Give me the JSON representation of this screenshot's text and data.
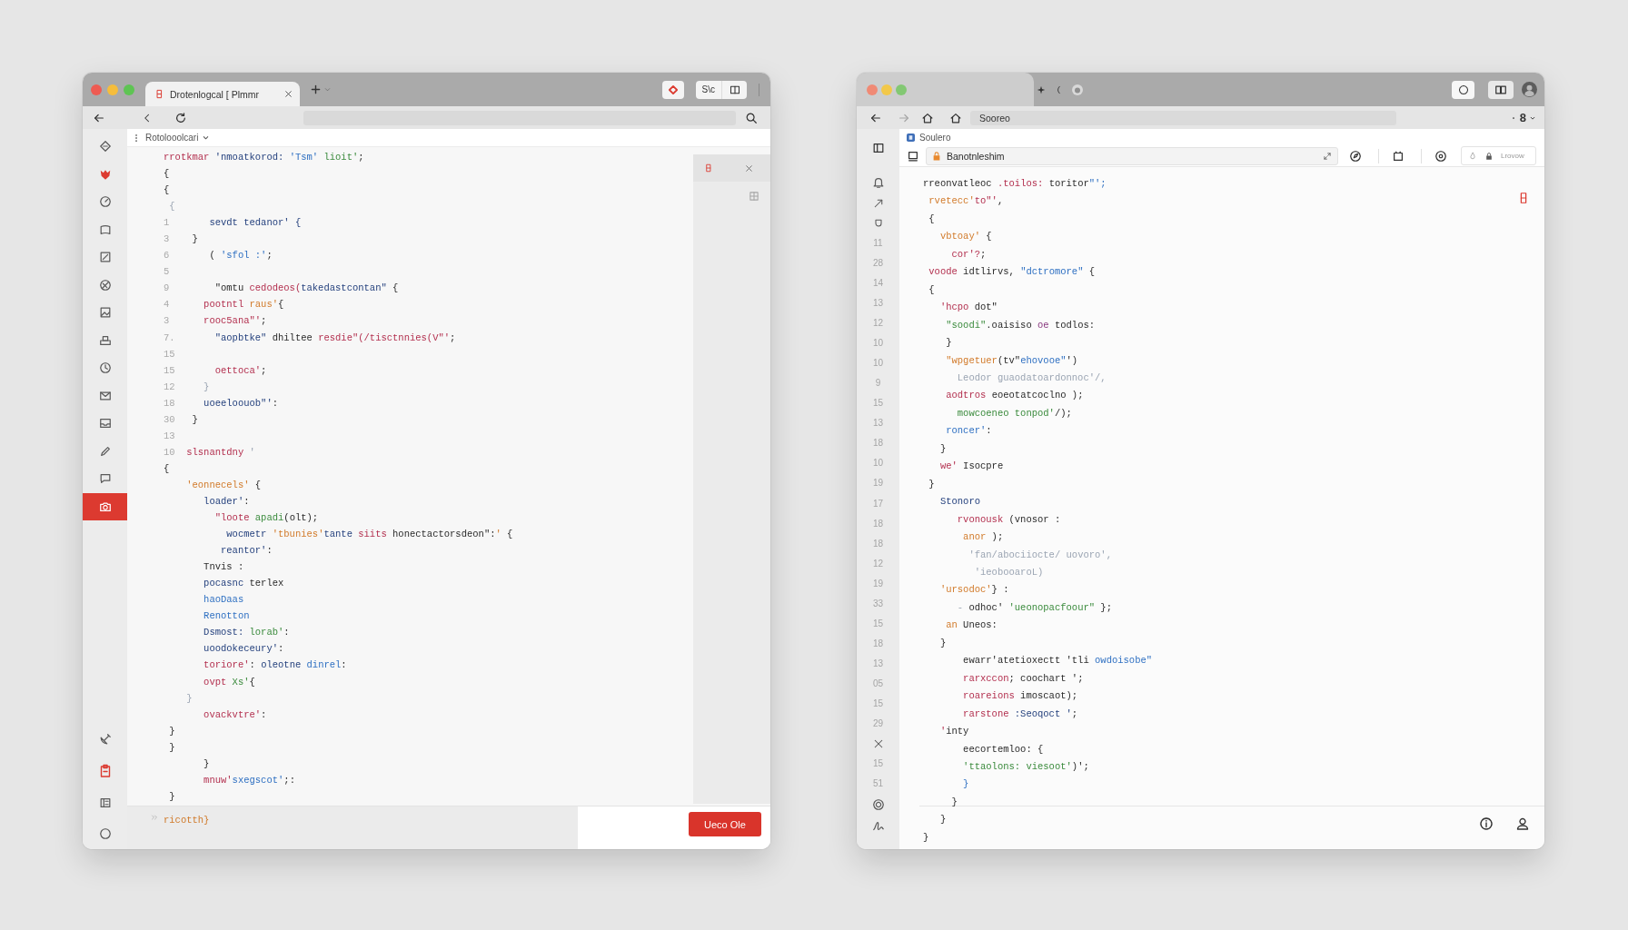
{
  "window_left": {
    "tab_title": "Drotenlogcal [ Plmmr",
    "titlebar_button": "S\\c",
    "breadcrumb": "Rotolooolcari",
    "sidebar": {
      "items": [
        {
          "selected": false
        },
        {
          "selected": false
        },
        {
          "selected": false
        },
        {
          "selected": false
        },
        {
          "selected": false
        },
        {
          "selected": false
        },
        {
          "selected": false
        },
        {
          "selected": false
        },
        {
          "selected": false
        },
        {
          "selected": false
        },
        {
          "selected": false
        },
        {
          "selected": false
        },
        {
          "selected": false
        },
        {
          "selected": true
        }
      ]
    },
    "code_lines": [
      {
        "code": [
          {
            "text": "rrotkmar ",
            "kind": "keyword"
          },
          {
            "text": "'nmoatkorod: ",
            "kind": "name"
          },
          {
            "text": "'Tsm' ",
            "kind": "type"
          },
          {
            "text": "lioit'",
            "kind": "string"
          },
          {
            "text": ";",
            "kind": "plain"
          }
        ]
      },
      {
        "code": [
          {
            "text": "{",
            "kind": "plain"
          }
        ]
      },
      {
        "code": [
          {
            "text": "{",
            "kind": "plain"
          }
        ]
      },
      {
        "code": [
          {
            "text": " {",
            "kind": "muted"
          }
        ]
      },
      {
        "num": "1",
        "code": [
          {
            "text": "        sevdt tedanor' {",
            "kind": "name"
          }
        ]
      },
      {
        "num": "3",
        "code": [
          {
            "text": "     }",
            "kind": "plain"
          }
        ]
      },
      {
        "num": "6",
        "code": [
          {
            "text": "        ( ",
            "kind": "plain"
          },
          {
            "text": "'sfol :'",
            "kind": "type"
          },
          {
            "text": ";",
            "kind": "plain"
          }
        ]
      },
      {
        "num": "5"
      },
      {
        "num": "9",
        "code": [
          {
            "text": "         \"omtu ",
            "kind": "plain"
          },
          {
            "text": "cedodeos(",
            "kind": "keyword"
          },
          {
            "text": "takedastcontan\"",
            "kind": "name"
          },
          {
            "text": " {",
            "kind": "plain"
          }
        ]
      },
      {
        "num": "4",
        "code": [
          {
            "text": "       pootntl ",
            "kind": "keyword"
          },
          {
            "text": "raus'",
            "kind": "attr"
          },
          {
            "text": "{",
            "kind": "plain"
          }
        ]
      },
      {
        "num": "3",
        "code": [
          {
            "text": "       rooc5ana\"'",
            "kind": "keyword"
          },
          {
            "text": ";",
            "kind": "plain"
          }
        ]
      },
      {
        "num": "7.",
        "code": [
          {
            "text": "         \"aopbtke\" ",
            "kind": "name"
          },
          {
            "text": "dhiltee ",
            "kind": "plain"
          },
          {
            "text": "resdie\"(/tisctnnies(V\"'",
            "kind": "keyword"
          },
          {
            "text": ";",
            "kind": "plain"
          }
        ]
      },
      {
        "num": "15"
      },
      {
        "num": "15",
        "code": [
          {
            "text": "         oettoca'",
            "kind": "keyword"
          },
          {
            "text": ";",
            "kind": "plain"
          }
        ]
      },
      {
        "num": "12",
        "code": [
          {
            "text": "       }",
            "kind": "muted"
          }
        ]
      },
      {
        "num": "18",
        "code": [
          {
            "text": "       uoeeloouob\"'",
            "kind": "name"
          },
          {
            "text": ":",
            "kind": "plain"
          }
        ]
      },
      {
        "num": "30",
        "code": [
          {
            "text": "     }",
            "kind": "plain"
          }
        ]
      },
      {
        "num": "13"
      },
      {
        "num": "10",
        "code": [
          {
            "text": "    slsnantdny ",
            "kind": "keyword"
          },
          {
            "text": "'",
            "kind": "muted"
          }
        ]
      },
      {
        "code": [
          {
            "text": "{",
            "kind": "plain"
          }
        ]
      },
      {
        "code": [
          {
            "text": "    'eonnecels'",
            "kind": "attr"
          },
          {
            "text": " {",
            "kind": "plain"
          }
        ]
      },
      {
        "code": [
          {
            "text": "       loader'",
            "kind": "name"
          },
          {
            "text": ":",
            "kind": "plain"
          }
        ]
      },
      {
        "code": [
          {
            "text": "         \"loote ",
            "kind": "keyword"
          },
          {
            "text": "apadi",
            "kind": "string"
          },
          {
            "text": "(olt);",
            "kind": "plain"
          }
        ]
      },
      {
        "code": [
          {
            "text": "           wocmetr ",
            "kind": "name"
          },
          {
            "text": "'tbunies'",
            "kind": "attr"
          },
          {
            "text": "tante ",
            "kind": "name"
          },
          {
            "text": "siits ",
            "kind": "keyword"
          },
          {
            "text": "honectactorsdeon\":",
            "kind": "plain"
          },
          {
            "text": "'",
            "kind": "attr"
          },
          {
            "text": " {",
            "kind": "plain"
          }
        ]
      },
      {
        "code": [
          {
            "text": "          reantor'",
            "kind": "name"
          },
          {
            "text": ":",
            "kind": "plain"
          }
        ]
      },
      {
        "code": [
          {
            "text": "       Tnvis :",
            "kind": "plain"
          }
        ]
      },
      {
        "code": [
          {
            "text": "       pocasnc ",
            "kind": "name"
          },
          {
            "text": "terlex",
            "kind": "plain"
          }
        ]
      },
      {
        "code": [
          {
            "text": "       haoDaas",
            "kind": "type"
          }
        ]
      },
      {
        "code": [
          {
            "text": "       Renotton",
            "kind": "type"
          }
        ]
      },
      {
        "code": [
          {
            "text": "       Dsmost: ",
            "kind": "name"
          },
          {
            "text": "lorab'",
            "kind": "string"
          },
          {
            "text": ":",
            "kind": "plain"
          }
        ]
      },
      {
        "code": [
          {
            "text": "       uoodokeceury'",
            "kind": "name"
          },
          {
            "text": ":",
            "kind": "plain"
          }
        ]
      },
      {
        "code": [
          {
            "text": "       toriore'",
            "kind": "keyword"
          },
          {
            "text": ": ",
            "kind": "plain"
          },
          {
            "text": "oleotne ",
            "kind": "name"
          },
          {
            "text": "dinrel",
            "kind": "type"
          },
          {
            "text": ":",
            "kind": "plain"
          }
        ]
      },
      {
        "code": [
          {
            "text": "       ovpt ",
            "kind": "keyword"
          },
          {
            "text": "Xs'",
            "kind": "string"
          },
          {
            "text": "{",
            "kind": "plain"
          }
        ]
      },
      {
        "code": [
          {
            "text": "    }",
            "kind": "muted"
          }
        ]
      },
      {
        "code": [
          {
            "text": "       ovackvtre'",
            "kind": "keyword"
          },
          {
            "text": ":",
            "kind": "plain"
          }
        ]
      },
      {
        "code": [
          {
            "text": " }",
            "kind": "plain"
          }
        ]
      },
      {
        "code": [
          {
            "text": " }",
            "kind": "plain"
          }
        ]
      },
      {
        "code": [
          {
            "text": "       }",
            "kind": "plain"
          }
        ]
      },
      {
        "code": [
          {
            "text": "       mnuw'",
            "kind": "keyword"
          },
          {
            "text": "sxegscot'",
            "kind": "type"
          },
          {
            "text": ";:",
            "kind": "plain"
          }
        ]
      },
      {
        "code": [
          {
            "text": " }",
            "kind": "plain"
          }
        ]
      }
    ],
    "status_bar": {
      "text": "ricotth}"
    },
    "button": "Ueco Ole"
  },
  "window_right": {
    "address_field": {
      "value": "Sooreo"
    },
    "tab_count": "8",
    "breadcrumb": "Soulero",
    "search_field": {
      "value": "Banotnleshim"
    },
    "toolbar_button": "Lrovow",
    "line_numbers": [
      "11",
      "28",
      "14",
      "13",
      "12",
      "10",
      "10",
      "9",
      "15",
      "13",
      "18",
      "10",
      "19",
      "17",
      "18",
      "18",
      "12",
      "19",
      "33",
      "15",
      "18",
      "13",
      "05",
      "15",
      "29"
    ],
    "lower_line_numbers": [
      "15",
      "51"
    ],
    "code_lines": [
      {
        "code": [
          {
            "text": "rreonvatleoc ",
            "kind": "plain"
          },
          {
            "text": ".toilos: ",
            "kind": "keyword"
          },
          {
            "text": "toritor",
            "kind": "plain"
          },
          {
            "text": "\"';",
            "kind": "type"
          }
        ]
      },
      {
        "code": [
          {
            "text": " rvetecc'",
            "kind": "attr"
          },
          {
            "text": "to\"'",
            "kind": "keyword"
          },
          {
            "text": ",",
            "kind": "plain"
          }
        ]
      },
      {
        "code": [
          {
            "text": " {",
            "kind": "plain"
          }
        ]
      },
      {
        "code": [
          {
            "text": "   vbtoay'",
            "kind": "attr"
          },
          {
            "text": " {",
            "kind": "plain"
          }
        ]
      },
      {
        "code": [
          {
            "text": "     cor'?",
            "kind": "keyword"
          },
          {
            "text": ";",
            "kind": "plain"
          }
        ]
      },
      {
        "code": [
          {
            "text": " voode ",
            "kind": "keyword"
          },
          {
            "text": "idtlirvs, ",
            "kind": "plain"
          },
          {
            "text": "\"dctromore\"",
            "kind": "type"
          },
          {
            "text": " {",
            "kind": "plain"
          }
        ]
      },
      {
        "code": [
          {
            "text": " {",
            "kind": "plain"
          }
        ]
      },
      {
        "code": [
          {
            "text": "   'hcpo ",
            "kind": "keyword"
          },
          {
            "text": "dot\"",
            "kind": "plain"
          }
        ]
      },
      {
        "code": [
          {
            "text": "    \"soodi\"",
            "kind": "string"
          },
          {
            "text": ".oaisiso ",
            "kind": "plain"
          },
          {
            "text": "oe ",
            "kind": "constant"
          },
          {
            "text": "todlos:",
            "kind": "plain"
          }
        ]
      },
      {
        "code": [
          {
            "text": "    }",
            "kind": "plain"
          }
        ]
      },
      {
        "code": [
          {
            "text": "    \"wpgetuer",
            "kind": "attr"
          },
          {
            "text": "(tv\"",
            "kind": "plain"
          },
          {
            "text": "ehovooe\"",
            "kind": "type"
          },
          {
            "text": "')",
            "kind": "plain"
          }
        ]
      },
      {
        "code": [
          {
            "text": "      Leodor guaodatoardonnoc'/,",
            "kind": "muted"
          }
        ]
      },
      {
        "code": [
          {
            "text": "    aodtros ",
            "kind": "keyword"
          },
          {
            "text": "eoeotatcoclno );",
            "kind": "plain"
          }
        ]
      },
      {
        "code": [
          {
            "text": "      mowcoeneo tonpod'",
            "kind": "string"
          },
          {
            "text": "/);",
            "kind": "plain"
          }
        ]
      },
      {
        "code": [
          {
            "text": "    roncer'",
            "kind": "type"
          },
          {
            "text": ":",
            "kind": "plain"
          }
        ]
      },
      {
        "code": [
          {
            "text": "   }",
            "kind": "plain"
          }
        ]
      },
      {
        "code": [
          {
            "text": "   we' ",
            "kind": "keyword"
          },
          {
            "text": "Isocpre",
            "kind": "plain"
          }
        ]
      },
      {
        "code": [
          {
            "text": " }",
            "kind": "plain"
          }
        ]
      },
      {
        "code": [
          {
            "text": "   Stonoro",
            "kind": "name"
          }
        ]
      },
      {
        "code": [
          {
            "text": "      rvonousk ",
            "kind": "keyword"
          },
          {
            "text": "(vnosor :",
            "kind": "plain"
          }
        ]
      },
      {
        "code": [
          {
            "text": "       anor ",
            "kind": "attr"
          },
          {
            "text": ");",
            "kind": "plain"
          }
        ]
      },
      {
        "code": [
          {
            "text": "        'fan/abociiocte/ uovoro',",
            "kind": "muted"
          }
        ]
      },
      {
        "code": [
          {
            "text": "         'ieobooaroL)",
            "kind": "muted"
          }
        ]
      },
      {
        "code": [
          {
            "text": "   'ursodoc'",
            "kind": "attr"
          },
          {
            "text": "} :",
            "kind": "plain"
          }
        ]
      },
      {
        "code": [
          {
            "text": "      - ",
            "kind": "muted"
          },
          {
            "text": "odhoc' ",
            "kind": "plain"
          },
          {
            "text": "'ueonopacfoour\"",
            "kind": "string"
          },
          {
            "text": " };",
            "kind": "plain"
          }
        ]
      },
      {
        "code": [
          {
            "text": "    an ",
            "kind": "attr"
          },
          {
            "text": "Uneos:",
            "kind": "plain"
          }
        ]
      },
      {
        "code": [
          {
            "text": "   }",
            "kind": "plain"
          }
        ]
      },
      {
        "code": [
          {
            "text": "       ewarr'atetioxectt 'tli ",
            "kind": "plain"
          },
          {
            "text": "owdoisobe\"",
            "kind": "type"
          }
        ]
      },
      {
        "code": [
          {
            "text": "       rarxccon",
            "kind": "keyword"
          },
          {
            "text": "; coochart ';",
            "kind": "plain"
          }
        ]
      },
      {
        "code": [
          {
            "text": "       roareions ",
            "kind": "keyword"
          },
          {
            "text": "imoscaot);",
            "kind": "plain"
          }
        ]
      },
      {
        "code": [
          {
            "text": "       rarstone ",
            "kind": "keyword"
          },
          {
            "text": ":Seoqoct '",
            "kind": "name"
          },
          {
            "text": ";",
            "kind": "plain"
          }
        ]
      },
      {
        "code": [
          {
            "text": "   '",
            "kind": "keyword"
          },
          {
            "text": "inty",
            "kind": "plain"
          }
        ]
      },
      {
        "code": [
          {
            "text": "       eecortemloo: {",
            "kind": "plain"
          }
        ]
      },
      {
        "code": [
          {
            "text": "       'ttaolons: viesoot'",
            "kind": "string"
          },
          {
            "text": ")';",
            "kind": "plain"
          }
        ]
      },
      {
        "code": [
          {
            "text": "       }",
            "kind": "type"
          }
        ]
      },
      {
        "code": [
          {
            "text": "     }",
            "kind": "plain"
          }
        ]
      },
      {
        "code": [
          {
            "text": "   }",
            "kind": "plain"
          }
        ]
      },
      {
        "code": [
          {
            "text": "}",
            "kind": "plain"
          }
        ]
      }
    ]
  }
}
